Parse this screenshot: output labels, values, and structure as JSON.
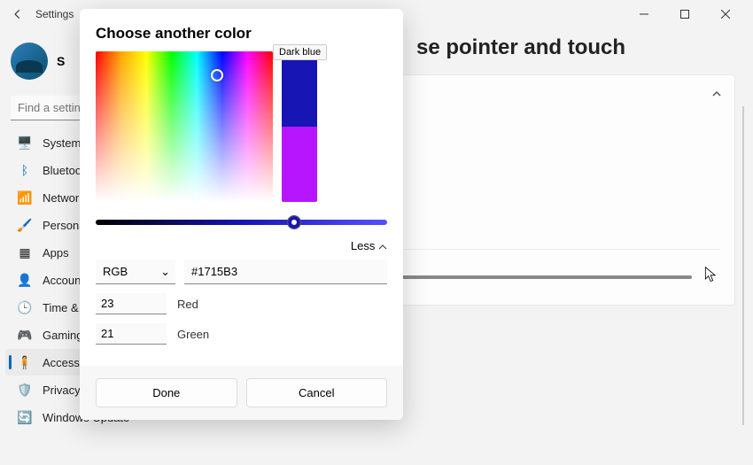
{
  "titlebar": {
    "app": "Settings"
  },
  "profile": {
    "initial": "S"
  },
  "search": {
    "placeholder": "Find a setting"
  },
  "nav": {
    "items": [
      {
        "label": "System"
      },
      {
        "label": "Bluetooth"
      },
      {
        "label": "Network"
      },
      {
        "label": "Personalization"
      },
      {
        "label": "Apps"
      },
      {
        "label": "Accounts"
      },
      {
        "label": "Time & language"
      },
      {
        "label": "Gaming"
      },
      {
        "label": "Accessibility"
      },
      {
        "label": "Privacy"
      },
      {
        "label": "Windows Update"
      }
    ]
  },
  "page": {
    "title_fragment": "se pointer and touch"
  },
  "colors": {
    "swatches": [
      "#0099cc",
      "#00cc99"
    ]
  },
  "dialog": {
    "title": "Choose another color",
    "tooltip": "Dark blue",
    "preview_top": "#1715B3",
    "preview_bottom": "#b815ff",
    "less_label": "Less",
    "mode": "RGB",
    "hex": "#1715B3",
    "red": {
      "value": "23",
      "label": "Red"
    },
    "green": {
      "value": "21",
      "label": "Green"
    },
    "done": "Done",
    "cancel": "Cancel"
  }
}
